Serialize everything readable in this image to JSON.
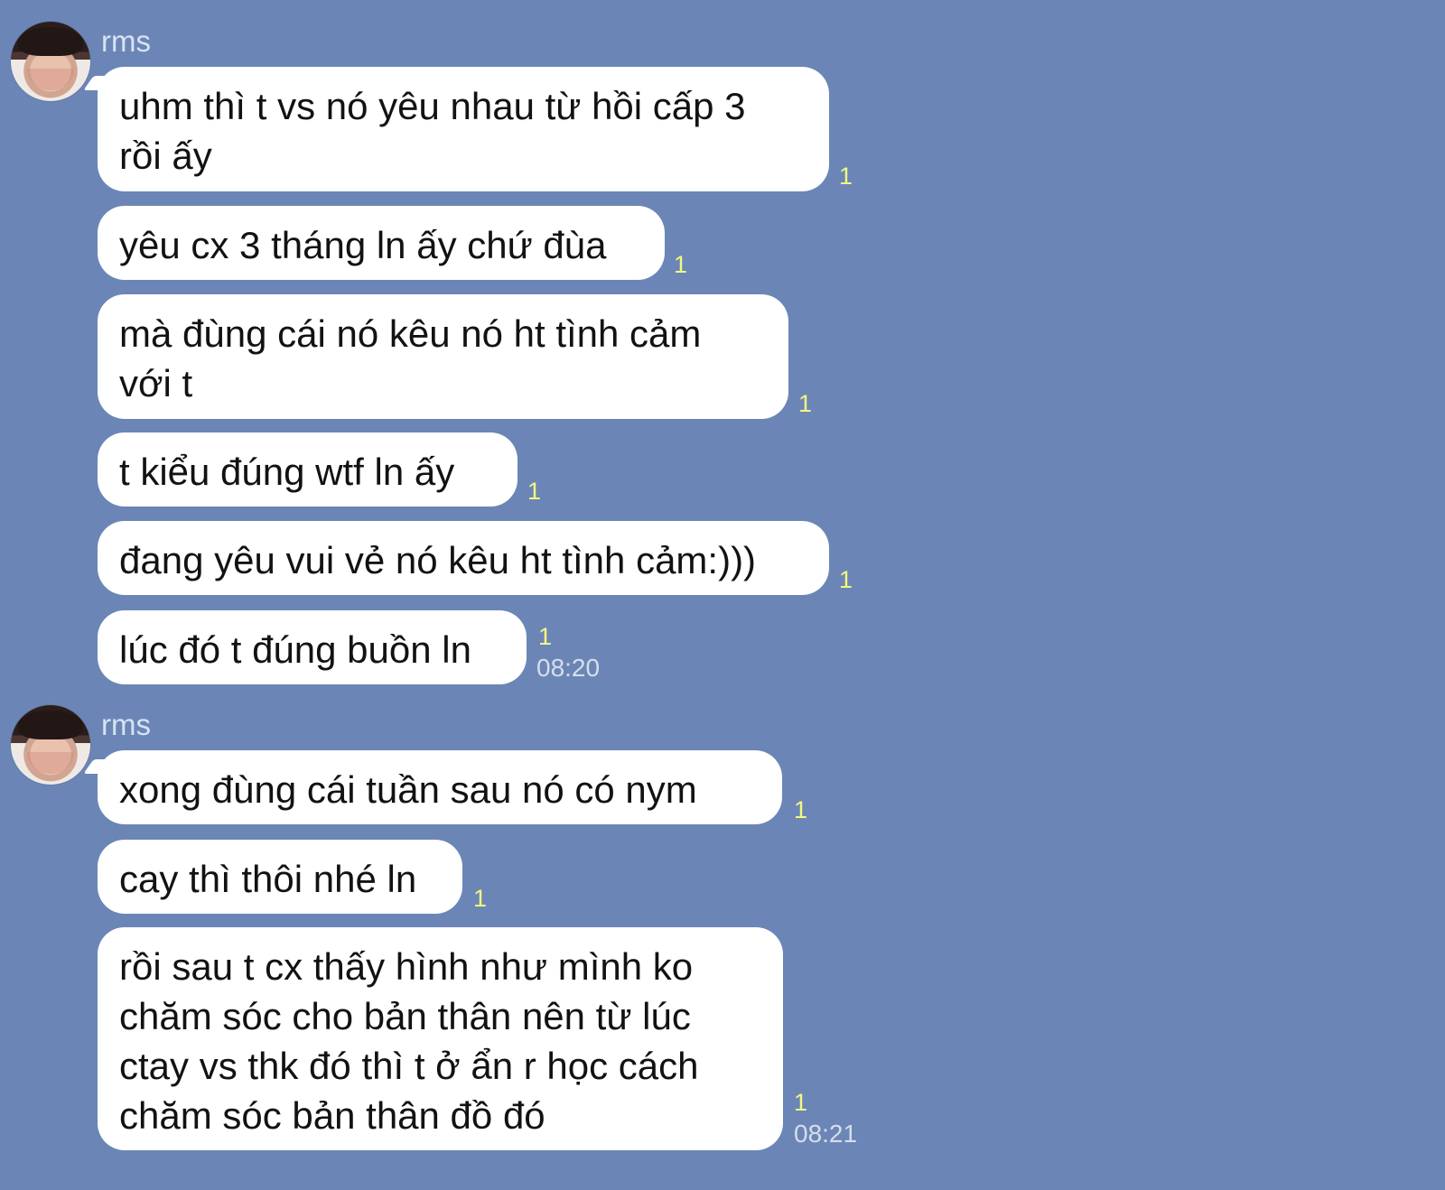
{
  "chat": {
    "groups": [
      {
        "sender": "rms",
        "messages": [
          {
            "text_lines": [
              "uhm thì t vs nó yêu nhau từ hồi cấp 3",
              "rồi ấy"
            ],
            "read": "1"
          },
          {
            "text_lines": [
              "yêu cx 3 tháng ln ấy chứ đùa"
            ],
            "read": "1"
          },
          {
            "text_lines": [
              "mà đùng cái nó kêu nó ht tình cảm",
              "với t"
            ],
            "read": "1"
          },
          {
            "text_lines": [
              "t kiểu đúng wtf ln ấy"
            ],
            "read": "1"
          },
          {
            "text_lines": [
              "đang yêu vui vẻ nó kêu ht tình cảm:)))"
            ],
            "read": "1"
          },
          {
            "text_lines": [
              "lúc đó t đúng buồn ln"
            ],
            "read": "1",
            "time": "08:20"
          }
        ]
      },
      {
        "sender": "rms",
        "messages": [
          {
            "text_lines": [
              "xong đùng cái tuần sau nó có nym"
            ],
            "read": "1"
          },
          {
            "text_lines": [
              "cay thì thôi nhé ln"
            ],
            "read": "1"
          },
          {
            "text_lines": [
              "rồi sau t cx thấy hình như mình ko",
              "chăm sóc cho bản thân nên từ lúc",
              "ctay vs thk đó thì t ở ẩn r học cách",
              "chăm sóc bản thân đồ đó"
            ],
            "read": "1",
            "time": "08:21"
          }
        ]
      }
    ]
  }
}
